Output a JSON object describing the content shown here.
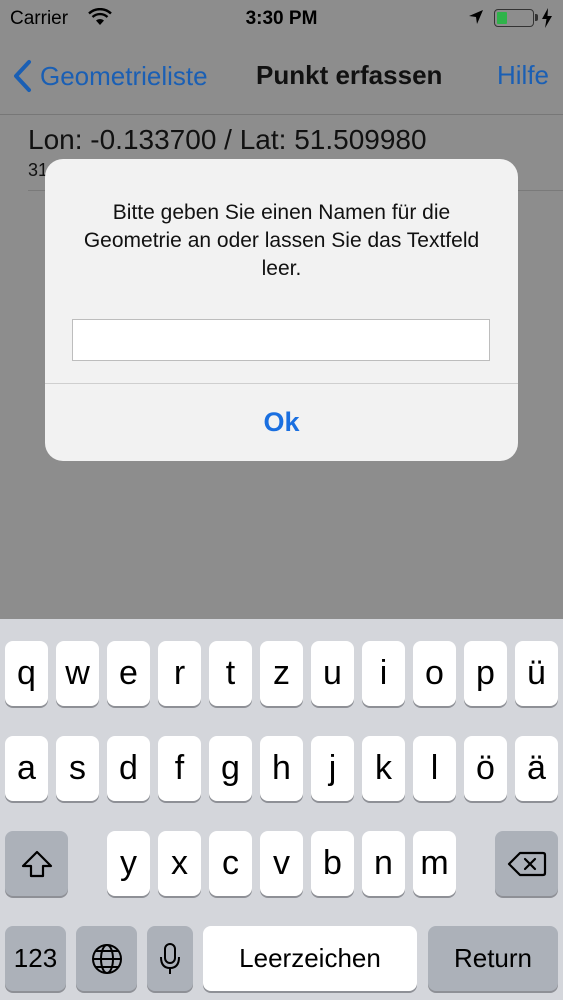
{
  "status_bar": {
    "carrier": "Carrier",
    "time": "3:30 PM",
    "battery_level": 0.3
  },
  "nav": {
    "back_label": "Geometrieliste",
    "title": "Punkt erfassen",
    "help_label": "Hilfe"
  },
  "content": {
    "coordinates": "Lon: -0.133700 / Lat: 51.509980",
    "subline": "31"
  },
  "alert": {
    "message": "Bitte geben Sie einen Namen für die Geometrie an oder lassen Sie das Textfeld leer.",
    "input_value": "",
    "ok_label": "Ok"
  },
  "keyboard": {
    "row1": [
      "q",
      "w",
      "e",
      "r",
      "t",
      "z",
      "u",
      "i",
      "o",
      "p",
      "ü"
    ],
    "row2": [
      "a",
      "s",
      "d",
      "f",
      "g",
      "h",
      "j",
      "k",
      "l",
      "ö",
      "ä"
    ],
    "row3": [
      "y",
      "x",
      "c",
      "v",
      "b",
      "n",
      "m"
    ],
    "numbers_label": "123",
    "space_label": "Leerzeichen",
    "return_label": "Return",
    "icons": {
      "shift": "shift-icon",
      "delete": "delete-icon",
      "globe": "globe-icon",
      "mic": "microphone-icon"
    }
  }
}
